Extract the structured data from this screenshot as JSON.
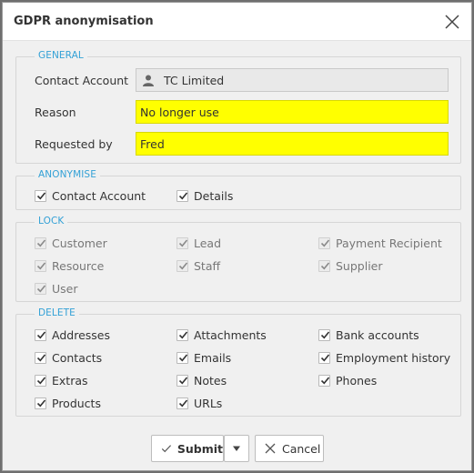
{
  "dialog": {
    "title": "GDPR anonymisation"
  },
  "general": {
    "legend": "GENERAL",
    "contact_account_label": "Contact Account",
    "contact_account_value": "TC Limited",
    "reason_label": "Reason",
    "reason_value": "No longer use",
    "requested_by_label": "Requested by",
    "requested_by_value": "Fred",
    "highlight_color": "#ffff00"
  },
  "anonymise": {
    "legend": "ANONYMISE",
    "items": [
      {
        "label": "Contact Account",
        "checked": true
      },
      {
        "label": "Details",
        "checked": true
      }
    ]
  },
  "lock": {
    "legend": "LOCK",
    "items": [
      {
        "label": "Customer",
        "checked": true,
        "disabled": true
      },
      {
        "label": "Lead",
        "checked": true,
        "disabled": true
      },
      {
        "label": "Payment Recipient",
        "checked": true,
        "disabled": true
      },
      {
        "label": "Resource",
        "checked": true,
        "disabled": true
      },
      {
        "label": "Staff",
        "checked": true,
        "disabled": true
      },
      {
        "label": "Supplier",
        "checked": true,
        "disabled": true
      },
      {
        "label": "User",
        "checked": true,
        "disabled": true
      }
    ]
  },
  "delete": {
    "legend": "DELETE",
    "items": [
      {
        "label": "Addresses",
        "checked": true
      },
      {
        "label": "Attachments",
        "checked": true
      },
      {
        "label": "Bank accounts",
        "checked": true
      },
      {
        "label": "Contacts",
        "checked": true
      },
      {
        "label": "Emails",
        "checked": true
      },
      {
        "label": "Employment history",
        "checked": true
      },
      {
        "label": "Extras",
        "checked": true
      },
      {
        "label": "Notes",
        "checked": true
      },
      {
        "label": "Phones",
        "checked": true
      },
      {
        "label": "Products",
        "checked": true
      },
      {
        "label": "URLs",
        "checked": true
      }
    ]
  },
  "footer": {
    "submit_label": "Submit",
    "cancel_label": "Cancel",
    "submit_icon": "check-icon",
    "dropdown_icon": "caret-down-icon",
    "cancel_icon": "x-icon"
  },
  "colors": {
    "legend": "#33a1d6"
  }
}
